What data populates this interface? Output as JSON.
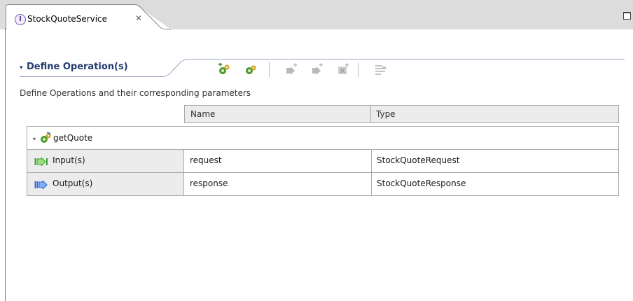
{
  "editor": {
    "tab_title": "StockQuoteService",
    "tab_close_glyph": "✕",
    "tab_icon_letter": "I"
  },
  "section": {
    "toggle_glyph": "▾",
    "title": "Define Operation(s)",
    "description": "Define Operations and their  corresponding parameters",
    "toolbar": [
      {
        "name": "add-request-response-operation-button",
        "icon": "add-operation-icon",
        "enabled": true
      },
      {
        "name": "add-one-way-operation-button",
        "icon": "add-one-way-operation-icon",
        "enabled": true
      },
      {
        "name": "add-input-button",
        "icon": "add-input-icon",
        "enabled": false
      },
      {
        "name": "add-output-button",
        "icon": "add-output-icon",
        "enabled": false
      },
      {
        "name": "add-fault-button",
        "icon": "add-fault-icon",
        "enabled": false
      },
      {
        "name": "show-in-table-button",
        "icon": "table-view-icon",
        "enabled": false
      }
    ]
  },
  "table": {
    "columns": [
      "Name",
      "Type"
    ],
    "operation": {
      "name": "getQuote",
      "toggle_glyph": "▾",
      "parameters": [
        {
          "kind": "Input(s)",
          "name": "request",
          "type": "StockQuoteRequest",
          "icon": "input-arrow-icon"
        },
        {
          "kind": "Output(s)",
          "name": "response",
          "type": "StockQuoteResponse",
          "icon": "output-arrow-icon"
        }
      ]
    }
  },
  "colors": {
    "tabstrip": "#dcdcdc",
    "section_title": "#233a6e",
    "grid_line": "#a9a9a9",
    "input_icon": "#3aa23a",
    "output_icon": "#2f66d6"
  }
}
